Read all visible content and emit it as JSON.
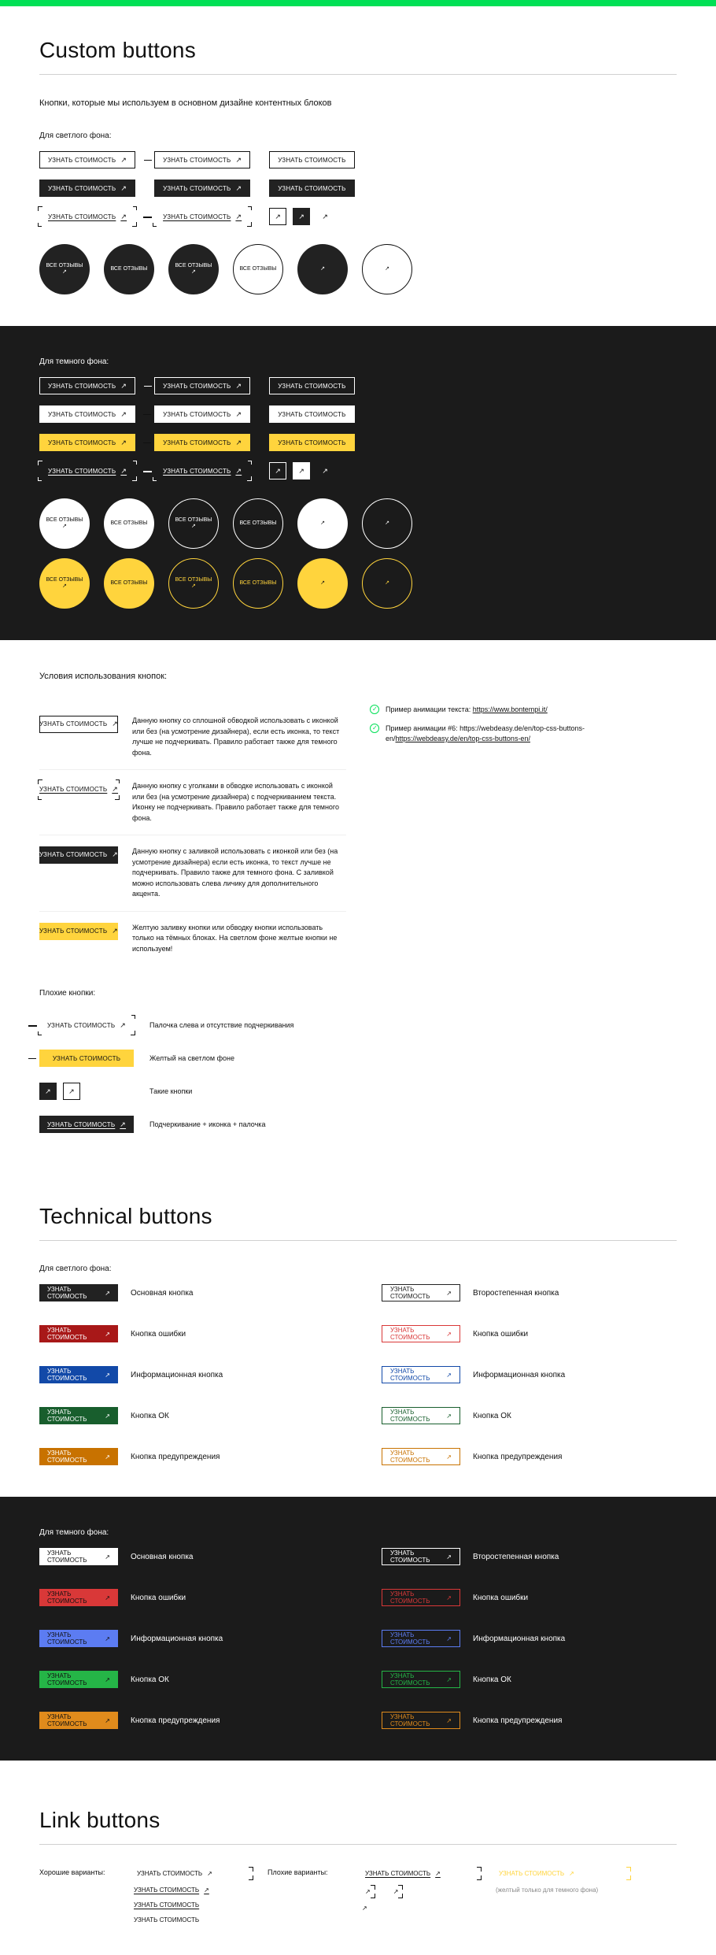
{
  "headings": {
    "custom": "Custom buttons",
    "tech": "Technical buttons",
    "link": "Link buttons",
    "subtitle": "Кнопки, которые мы используем в основном дизайне контентных блоков",
    "light_bg": "Для светлого фона:",
    "dark_bg": "Для темного фона:",
    "usage": "Условия использования кнопок:",
    "bad": "Плохие кнопки:",
    "good_variants": "Хорошие варианты:",
    "bad_variants": "Плохие варианты:"
  },
  "btn": {
    "primary": "УЗНАТЬ СТОИМОСТЬ",
    "circle": "ВСЕ ОТЗЫВЫ"
  },
  "arrow": "↗",
  "usage_rules": [
    "Данную кнопку со сплошной обводкой использовать с иконкой или без  (на усмотрение дизайнера), если есть иконка, то текст лучше не подчеркивать. Правило работает также для темного фона.",
    "Данную кнопку с уголками в обводке использовать с иконкой или без  (на усмотрение дизайнера) с подчеркиванием текста. Иконку не подчеркивать. Правило  работает также для темного фона.",
    "Данную кнопку с заливкой использовать с иконкой или без  (на усмотрение дизайнера) если есть иконка, то текст лучше не подчеркивать. Правило также для темного фона. С заливкой можно использовать слева личику для дополнительного акцента.",
    "Желтую заливку кнопки или обводку кнопки использовать только на тёмных блоках. На светлом фоне желтые кнопки не используем!"
  ],
  "notes": [
    {
      "pre": "Пример анимации текста:  ",
      "link": "https://www.bontempi.it/"
    },
    {
      "pre": "Пример анимации #6: https://webdeasy.de/en/top-css-buttons-en/",
      "link": "https://webdeasy.de/en/top-css-buttons-en/"
    }
  ],
  "bad_examples": [
    "Палочка слева и отсутствие подчеркивания",
    "Желтый на светлом фоне",
    "Такие кнопки",
    "Подчеркивание + иконка + палочка"
  ],
  "tech_rows_light": {
    "primary": {
      "label": "Основная кнопка",
      "fill": "#222222",
      "text": "#ffffff",
      "o_border": "#222222",
      "o_text": "#222222"
    },
    "error": {
      "label": "Кнопка ошибки",
      "fill": "#A81818",
      "text": "#ffffff",
      "o_border": "#D93838",
      "o_text": "#D93838"
    },
    "info": {
      "label": "Информационная кнопка",
      "fill": "#1249A8",
      "text": "#ffffff",
      "o_border": "#1249A8",
      "o_text": "#1249A8"
    },
    "ok": {
      "label": "Кнопка ОК",
      "fill": "#185E2D",
      "text": "#ffffff",
      "o_border": "#185E2D",
      "o_text": "#185E2D"
    },
    "warn": {
      "label": "Кнопка предупреждения",
      "fill": "#C87200",
      "text": "#ffffff",
      "o_border": "#C87200",
      "o_text": "#C87200"
    },
    "second": {
      "label": "Второстепенная кнопка"
    }
  },
  "tech_rows_dark": {
    "primary": {
      "label": "Основная кнопка",
      "fill": "#ffffff",
      "text": "#111111",
      "o_border": "#ffffff",
      "o_text": "#ffffff"
    },
    "error": {
      "label": "Кнопка ошибки",
      "fill": "#D93838",
      "text": "#111111",
      "o_border": "#D93838",
      "o_text": "#D93838"
    },
    "info": {
      "label": "Информационная кнопка",
      "fill": "#5C7CF2",
      "text": "#111111",
      "o_border": "#5C7CF2",
      "o_text": "#5C7CF2"
    },
    "ok": {
      "label": "Кнопка ОК",
      "fill": "#25B547",
      "text": "#111111",
      "o_border": "#25B547",
      "o_text": "#25B547"
    },
    "warn": {
      "label": "Кнопка предупреждения",
      "fill": "#E08B1C",
      "text": "#111111",
      "o_border": "#E08B1C",
      "o_text": "#E08B1C"
    },
    "second": {
      "label": "Второстепенная кнопка"
    }
  },
  "link_section": {
    "yellow_note": "УЗНАТЬ СТОИМОСТЬ",
    "yellow_sub": "(желтый только для темного фона)"
  }
}
